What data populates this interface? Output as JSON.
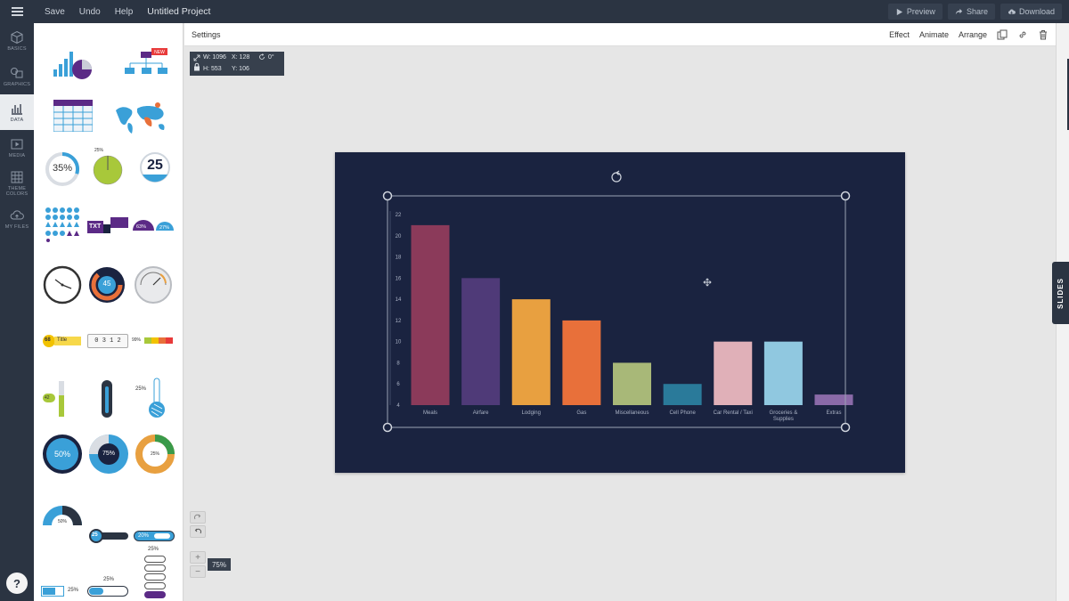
{
  "topbar": {
    "menu": [
      "Save",
      "Undo",
      "Help"
    ],
    "project_title": "Untitled Project",
    "preview": "Preview",
    "share": "Share",
    "download": "Download"
  },
  "rail": {
    "items": [
      {
        "label": "BASICS",
        "icon": "cube-icon"
      },
      {
        "label": "GRAPHICS",
        "icon": "shapes-icon"
      },
      {
        "label": "DATA",
        "icon": "chart-icon"
      },
      {
        "label": "MEDIA",
        "icon": "play-icon"
      },
      {
        "label": "THEME COLORS",
        "icon": "palette-icon"
      },
      {
        "label": "MY FILES",
        "icon": "cloud-icon"
      }
    ],
    "active": "DATA",
    "help": "?"
  },
  "widgets": {
    "new_badge": "NEW",
    "progress_35": "35%",
    "progress_25_small": "25%",
    "counter_25": "25",
    "txt_label": "TXT",
    "semi_63": "63%",
    "semi_27": "27%",
    "donut_45": "45",
    "title_68": "68",
    "title_label": "Title",
    "counter_digits": "0 3 1 2",
    "bar_pct": "99%",
    "thermo_small": "42",
    "thermo_pct": "25%",
    "circle_50": "50%",
    "circle_75": "75%",
    "ring_25": "25%",
    "gauge_half": "50%",
    "slider_25": "25",
    "toggle_20": "20%",
    "battery_25": "25%",
    "bar_25": "25%",
    "stack_25": "25%"
  },
  "settings_bar": {
    "label": "Settings",
    "effect": "Effect",
    "animate": "Animate",
    "arrange": "Arrange"
  },
  "dims": {
    "w": "W: 1096",
    "x": "X: 128",
    "rotation": "0°",
    "h": "H: 553",
    "y": "Y: 106"
  },
  "zoom": {
    "level": "75%",
    "plus": "+",
    "minus": "−"
  },
  "slides_tab": "SLIDES",
  "chart_data": {
    "type": "bar",
    "categories": [
      "Meals",
      "Airfare",
      "Lodging",
      "Gas",
      "Miscellaneous",
      "Cell Phone",
      "Car Rental / Taxi",
      "Groceries & Supplies",
      "Extras"
    ],
    "values": [
      21,
      16,
      14,
      12,
      8,
      6,
      10,
      10,
      5
    ],
    "colors": [
      "#8b3a5a",
      "#4f3a78",
      "#e8a040",
      "#e8703a",
      "#a8b878",
      "#2a7a9a",
      "#e0b0b8",
      "#90c8e0",
      "#8a6aa8"
    ],
    "yticks": [
      4,
      6,
      8,
      10,
      12,
      14,
      16,
      18,
      20,
      22
    ],
    "ylim": [
      4,
      22
    ],
    "grid": false
  }
}
